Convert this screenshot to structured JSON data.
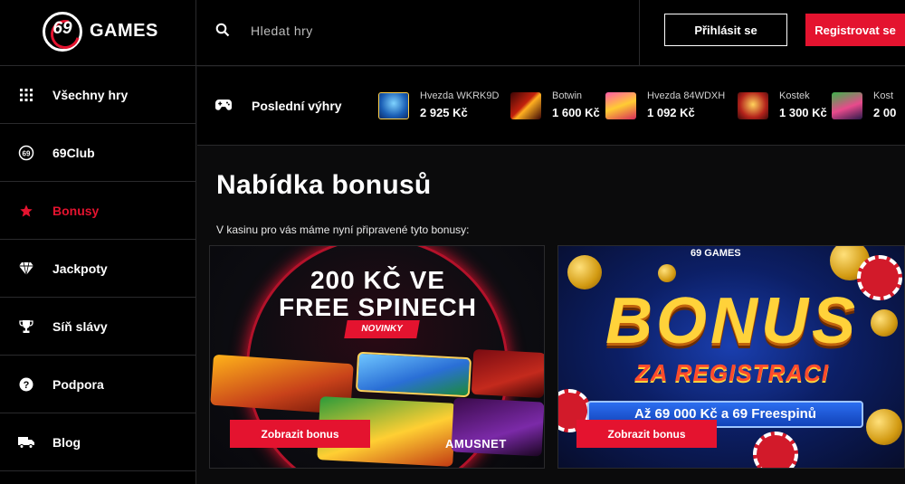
{
  "header": {
    "logo_number": "69",
    "logo_text": "GAMES",
    "search_placeholder": "Hledat hry",
    "login_label": "Přihlásit se",
    "register_label": "Registrovat se"
  },
  "sidebar": {
    "items": [
      {
        "label": "Všechny hry",
        "icon": "grid-icon",
        "active": false
      },
      {
        "label": "69Club",
        "icon": "club-69-icon",
        "active": false
      },
      {
        "label": "Bonusy",
        "icon": "star-icon",
        "active": true
      },
      {
        "label": "Jackpoty",
        "icon": "diamond-icon",
        "active": false
      },
      {
        "label": "Síň slávy",
        "icon": "trophy-icon",
        "active": false
      },
      {
        "label": "Podpora",
        "icon": "question-icon",
        "active": false
      },
      {
        "label": "Blog",
        "icon": "truck-icon",
        "active": false
      }
    ]
  },
  "recent_wins": {
    "title": "Poslední výhry",
    "items": [
      {
        "game": "Hvezda WKRK9D",
        "amount": "2 925 Kč"
      },
      {
        "game": "Botwin",
        "amount": "1 600 Kč"
      },
      {
        "game": "Hvezda 84WDXH",
        "amount": "1 092 Kč"
      },
      {
        "game": "Kostek",
        "amount": "1 300 Kč"
      },
      {
        "game": "Kost",
        "amount": "2 00"
      }
    ]
  },
  "main": {
    "title": "Nabídka bonusů",
    "subtitle": "V kasinu pro vás máme nyní připravené tyto bonusy:",
    "cards": [
      {
        "headline_1": "200 KČ VE",
        "headline_2": "FREE SPINECH",
        "tag": "NOVINKY",
        "brand": "AMUSNET",
        "button_label": "Zobrazit bonus"
      },
      {
        "logo": "69 GAMES",
        "headline_1": "BONUS",
        "headline_2": "ZA REGISTRACI",
        "offer": "Až 69 000 Kč a 69 Freespinů",
        "button_label": "Zobrazit bonus"
      }
    ]
  },
  "colors": {
    "accent": "#e4132f",
    "background": "#000000",
    "divider": "#2a2a2c"
  }
}
